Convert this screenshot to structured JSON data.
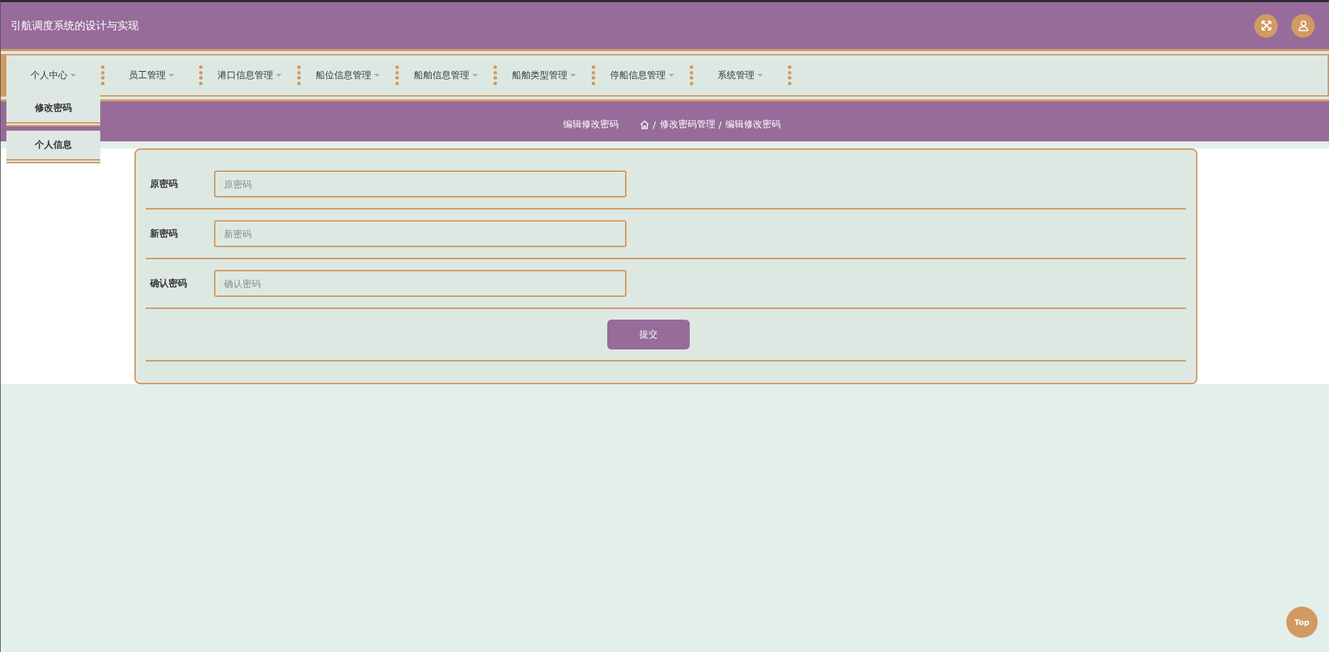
{
  "header": {
    "title": "引航调度系统的设计与实现"
  },
  "nav": {
    "items": [
      {
        "label": "个人中心",
        "children": [
          {
            "label": "修改密码"
          },
          {
            "label": "个人信息"
          }
        ]
      },
      {
        "label": "员工管理"
      },
      {
        "label": "港口信息管理"
      },
      {
        "label": "船位信息管理"
      },
      {
        "label": "船舶信息管理"
      },
      {
        "label": "船舶类型管理"
      },
      {
        "label": "停船信息管理"
      },
      {
        "label": "系统管理"
      }
    ]
  },
  "breadcrumb": {
    "title": "编辑修改密码",
    "separator": "/",
    "path": [
      "修改密码管理",
      "编辑修改密码"
    ]
  },
  "form": {
    "fields": [
      {
        "label": "原密码",
        "placeholder": "原密码"
      },
      {
        "label": "新密码",
        "placeholder": "新密码"
      },
      {
        "label": "确认密码",
        "placeholder": "确认密码"
      }
    ],
    "submit": "提交"
  },
  "top_button": "Top"
}
